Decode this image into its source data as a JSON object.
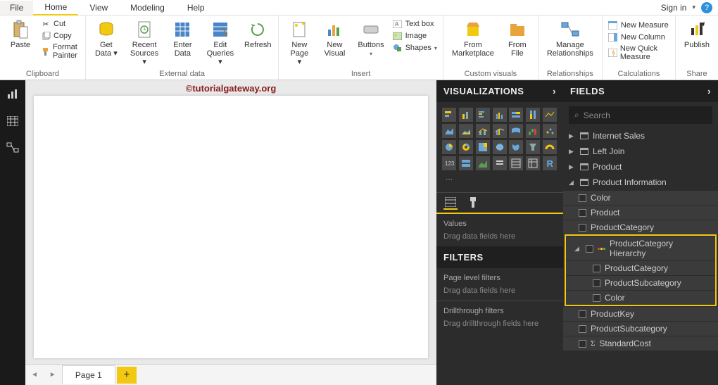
{
  "titlebar": {
    "file": "File",
    "tabs": [
      "Home",
      "View",
      "Modeling",
      "Help"
    ],
    "signin": "Sign in"
  },
  "ribbon": {
    "clipboard": {
      "label": "Clipboard",
      "paste": "Paste",
      "cut": "Cut",
      "copy": "Copy",
      "format_painter": "Format Painter"
    },
    "external": {
      "label": "External data",
      "get_data": "Get\nData",
      "recent": "Recent\nSources",
      "enter": "Enter\nData",
      "edit": "Edit\nQueries",
      "refresh": "Refresh"
    },
    "insert": {
      "label": "Insert",
      "new_page": "New\nPage",
      "new_visual": "New\nVisual",
      "buttons": "Buttons",
      "textbox": "Text box",
      "image": "Image",
      "shapes": "Shapes"
    },
    "custom": {
      "label": "Custom visuals",
      "marketplace": "From\nMarketplace",
      "file": "From\nFile"
    },
    "relationships": {
      "label": "Relationships",
      "manage": "Manage\nRelationships"
    },
    "calculations": {
      "label": "Calculations",
      "measure": "New Measure",
      "column": "New Column",
      "quick": "New Quick Measure"
    },
    "share": {
      "label": "Share",
      "publish": "Publish"
    }
  },
  "watermark": "©tutorialgateway.org",
  "pages": {
    "page1": "Page 1"
  },
  "viz": {
    "header": "VISUALIZATIONS",
    "values_label": "Values",
    "drag_fields": "Drag data fields here",
    "filters_header": "FILTERS",
    "page_filters": "Page level filters",
    "drag_filters": "Drag data fields here",
    "drill_header": "Drillthrough filters",
    "drag_drill": "Drag drillthrough fields here"
  },
  "fields": {
    "header": "FIELDS",
    "search": "Search",
    "tables": {
      "internet_sales": "Internet Sales",
      "left_join": "Left Join",
      "product": "Product",
      "product_info": "Product Information"
    },
    "columns": {
      "color": "Color",
      "product": "Product",
      "product_category": "ProductCategory",
      "hierarchy": "ProductCategory Hierarchy",
      "h_category": "ProductCategory",
      "h_subcategory": "ProductSubcategory",
      "h_color": "Color",
      "product_key": "ProductKey",
      "product_subcategory": "ProductSubcategory",
      "standard_cost": "StandardCost"
    }
  }
}
